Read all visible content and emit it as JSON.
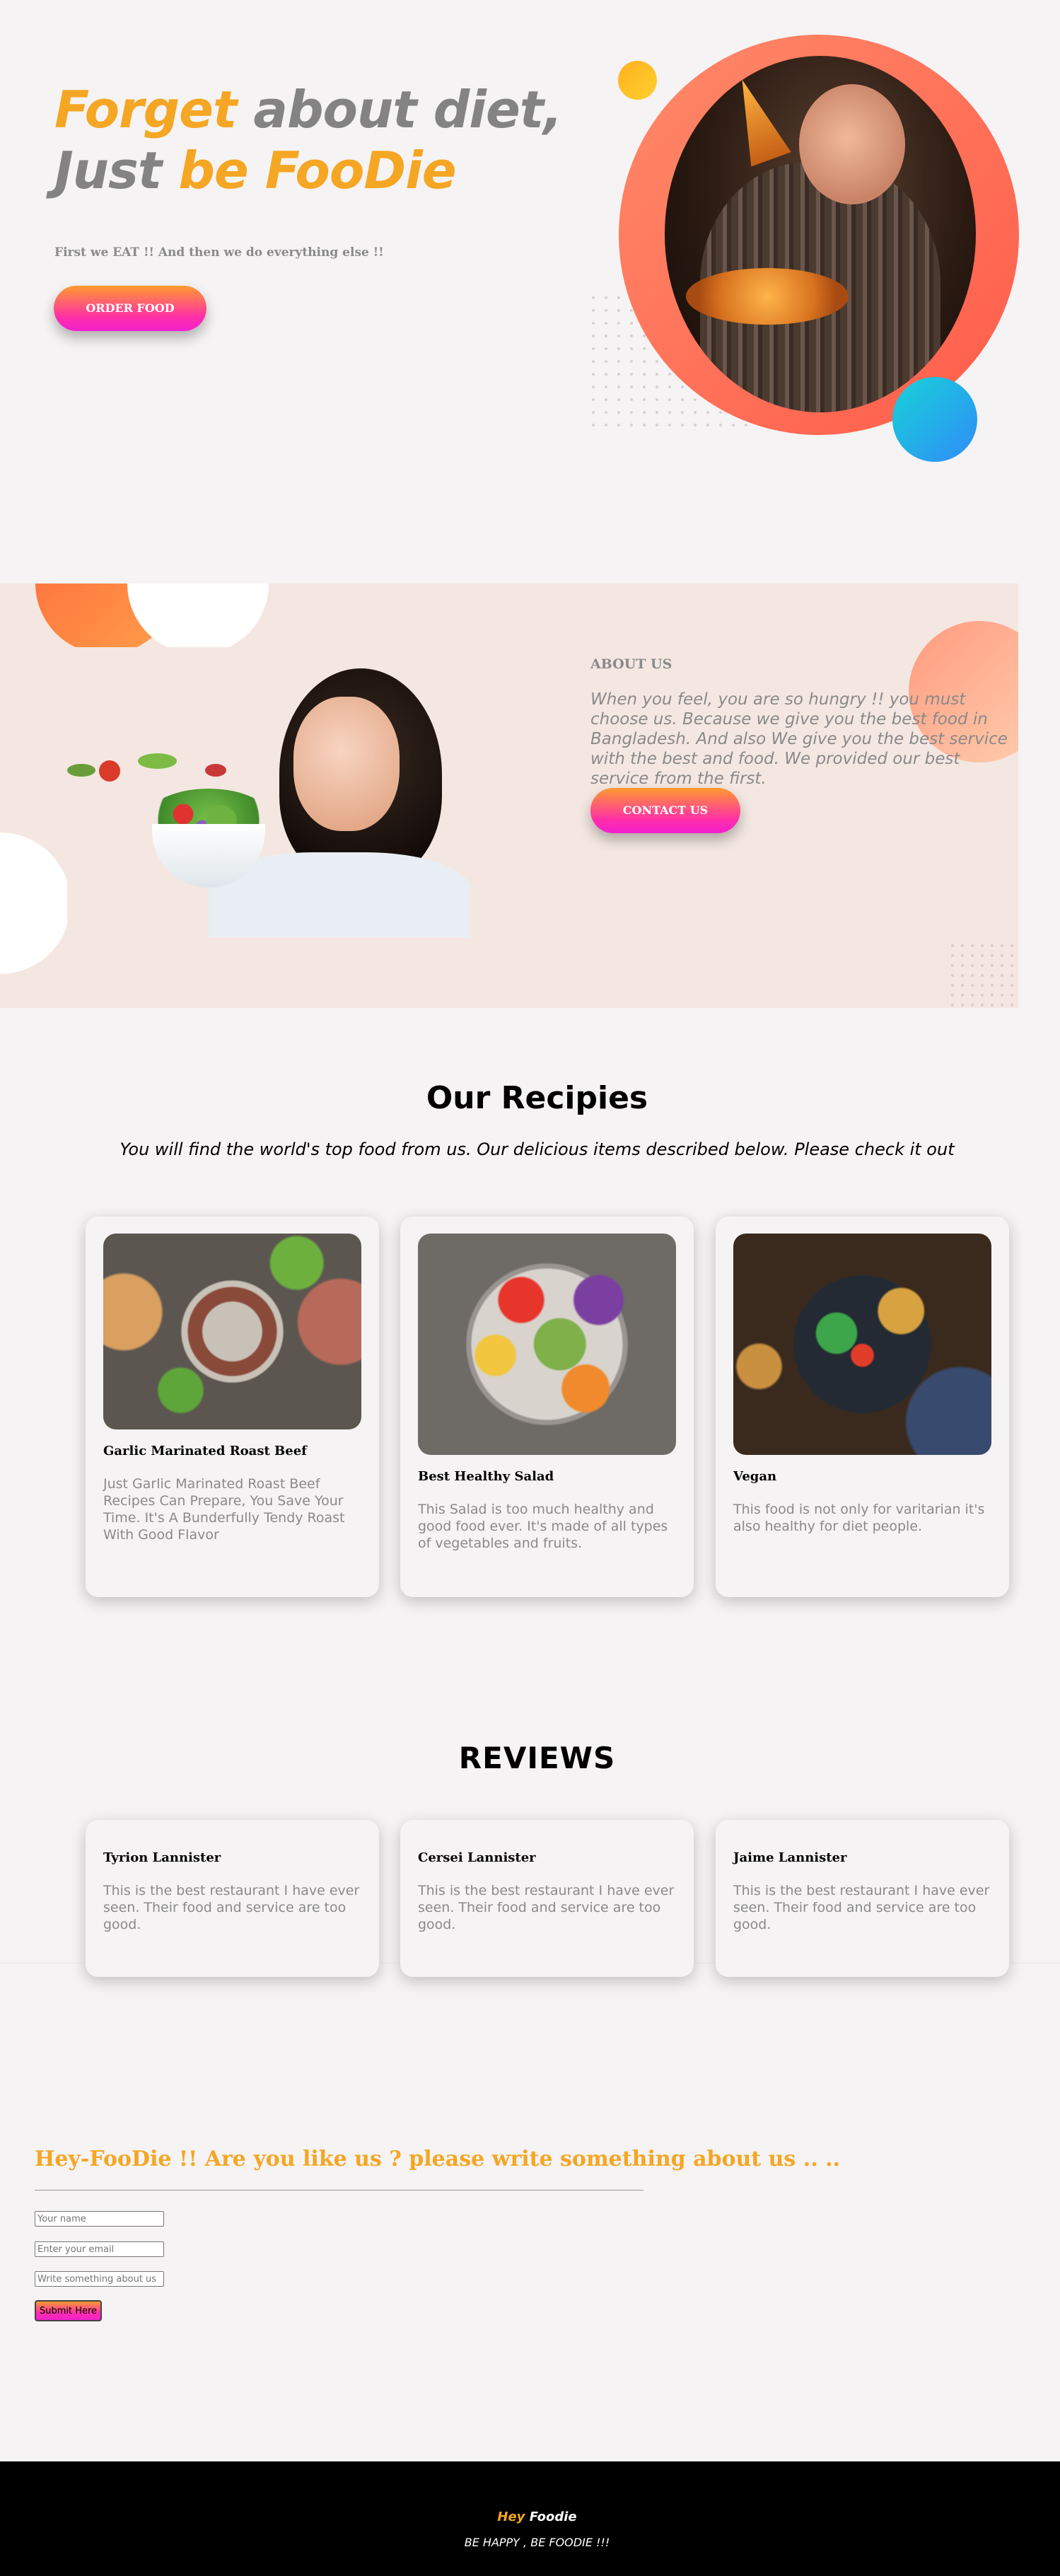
{
  "hero": {
    "title_line1_accent": "Forget",
    "title_line1_rest": " about diet,",
    "title_line2_plain": "Just ",
    "title_line2_accent": "be FooDie",
    "subtitle": "First we EAT !! And then we do everything else !!",
    "order_button": "ORDER FOOD",
    "image_icon": "man-eating-pizza-photo"
  },
  "about": {
    "heading": "ABOUT US",
    "text": "When you feel, you are so hungry !! you must choose us. Because we give you the best food in Bangladesh. And also We give you the best service with the best and food. We provided our best service from the first.",
    "contact_button": "CONTACT US",
    "image_icon": "woman-eating-salad-photo"
  },
  "recipes": {
    "title": "Our Recipies",
    "subtitle": "You will find the world's top food from us. Our delicious items described below. Please check it out",
    "items": [
      {
        "title": "Garlic Marinated Roast Beef",
        "desc": "Just Garlic Marinated Roast Beef Recipes Can Prepare, You Save Your Time. It's A Bunderfully Tendy Roast With Good Flavor"
      },
      {
        "title": "Best Healthy Salad",
        "desc": "This Salad is too much healthy and good food ever. It's made of all types of vegetables and fruits."
      },
      {
        "title": "Vegan",
        "desc": "This food is not only for varitarian it's also healthy for diet people."
      }
    ]
  },
  "reviews": {
    "title": "REVIEWS",
    "items": [
      {
        "name": "Tyrion Lannister",
        "text": "This is the best restaurant I have ever seen. Their food and service are too good."
      },
      {
        "name": "Cersei Lannister",
        "text": "This is the best restaurant I have ever seen. Their food and service are too good."
      },
      {
        "name": "Jaime Lannister",
        "text": "This is the best restaurant I have ever seen. Their food and service are too good."
      }
    ]
  },
  "form": {
    "title": "Hey-FooDie !! Are you like us ? please write something about us .. ..",
    "name_placeholder": "Your name",
    "email_placeholder": "Enter your email",
    "message_placeholder": "Write something about us",
    "submit_label": "Submit Here"
  },
  "footer": {
    "brand_accent": "Hey",
    "brand_rest": " Foodie",
    "tagline": "BE HAPPY , BE FOODIE !!!"
  },
  "colors": {
    "accent": "#f5a623",
    "button_gradient_start": "#ff9a2e",
    "button_gradient_end": "#f31fd0",
    "ring": "#ff6a55",
    "about_bg": "#f4e7e1",
    "footer_bg": "#000000"
  }
}
